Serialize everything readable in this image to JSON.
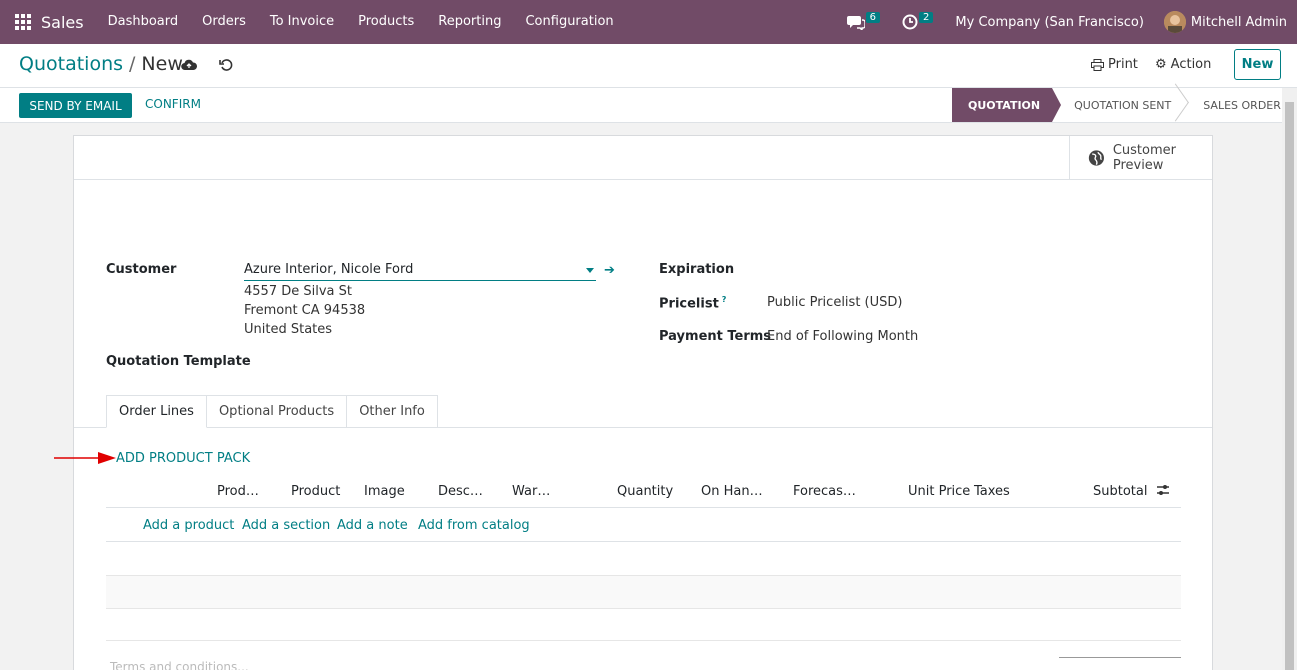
{
  "navbar": {
    "app_name": "Sales",
    "menu": [
      "Dashboard",
      "Orders",
      "To Invoice",
      "Products",
      "Reporting",
      "Configuration"
    ],
    "messages_count": "6",
    "activities_count": "2",
    "company": "My Company (San Francisco)",
    "user": "Mitchell Admin"
  },
  "control_panel": {
    "breadcrumb_parent": "Quotations",
    "breadcrumb_separator": "/",
    "breadcrumb_current": "New",
    "print_label": "Print",
    "action_label": "Action",
    "new_label": "New"
  },
  "statusbar": {
    "send_by_email": "SEND BY EMAIL",
    "confirm": "CONFIRM",
    "stages": [
      "QUOTATION",
      "QUOTATION SENT",
      "SALES ORDER"
    ],
    "active_stage": "QUOTATION"
  },
  "sheet": {
    "customer_preview": "Customer Preview",
    "customer_label": "Customer",
    "customer_value": "Azure Interior, Nicole Ford",
    "address_lines": [
      "4557 De Silva St",
      "Fremont CA 94538",
      "United States"
    ],
    "quotation_template_label": "Quotation Template",
    "expiration_label": "Expiration",
    "pricelist_label": "Pricelist",
    "pricelist_help": "?",
    "pricelist_value": "Public Pricelist (USD)",
    "payment_terms_label": "Payment Terms",
    "payment_terms_value": "End of Following Month"
  },
  "tabs": [
    "Order Lines",
    "Optional Products",
    "Other Info"
  ],
  "order_lines": {
    "add_product_pack": "ADD PRODUCT PACK",
    "columns": [
      "Prod…",
      "Product",
      "Image",
      "Desc…",
      "War…",
      "Quantity",
      "On Han…",
      "Forecas…",
      "Unit Price",
      "Taxes",
      "Subtotal"
    ],
    "add_links": [
      "Add a product",
      "Add a section",
      "Add a note",
      "Add from catalog"
    ],
    "terms_placeholder": "Terms and conditions..."
  },
  "colors": {
    "primary": "#714B67",
    "accent": "#017e84",
    "annotation_arrow": "#e00000"
  }
}
